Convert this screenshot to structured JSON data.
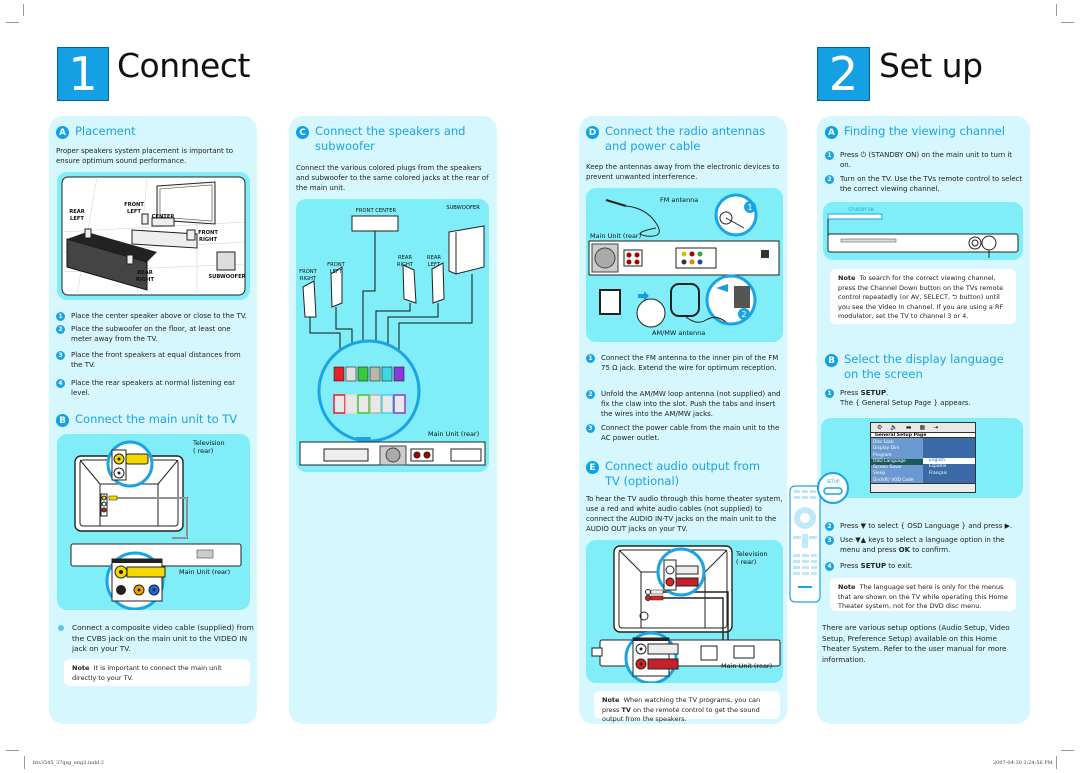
{
  "section1": {
    "number": "1",
    "title": "Connect",
    "A": {
      "letter": "A",
      "title": "Placement",
      "intro": "Proper speakers system placement is important to ensure optimum sound performance.",
      "illustration_labels": [
        "REAR LEFT",
        "FRONT LEFT",
        "CENTER",
        "FRONT RIGHT",
        "REAR RIGHT",
        "SUBWOOFER"
      ],
      "steps": [
        "Place the center speaker above or close to the TV.",
        "Place the subwoofer on the floor, at least one meter away from the TV.",
        "Place the front speakers at equal distances from the TV.",
        "Place the rear speakers at normal listening ear level."
      ]
    },
    "B": {
      "letter": "B",
      "title": "Connect the main unit to TV",
      "labels": {
        "television": "Television",
        "television_sub": "( rear)",
        "main_unit": "Main Unit (rear)"
      },
      "bullet": "Connect a composite video cable (supplied) from the CVBS jack on the main unit to the VIDEO IN jack on your TV.",
      "note_label": "Note",
      "note_text": "It is important to connect the main unit directly to your TV."
    },
    "C": {
      "letter": "C",
      "title": "Connect the speakers and subwoofer",
      "intro": "Connect the various colored plugs from the speakers and subwoofer to the same colored jacks at the rear of the main unit.",
      "labels": {
        "front_center": "FRONT CENTER",
        "subwoofer": "SUBWOOFER",
        "front_right": "FRONT RIGHT",
        "front_left": "FRONT LEFT",
        "rear_right": "REAR RIGHT",
        "rear_left": "REAR LEFT",
        "main_unit": "Main Unit (rear)"
      },
      "plug_colors": [
        "#e8202a",
        "#e0e0e0",
        "#3cc83c",
        "#b8b8a8",
        "#40d8e0",
        "#8a3ad8"
      ]
    },
    "D": {
      "letter": "D",
      "title": "Connect the radio antennas and power cable",
      "intro": "Keep the antennas away from the electronic devices to prevent unwanted interference.",
      "labels": {
        "fm": "FM antenna",
        "main_unit": "Main Unit (rear)",
        "am": "AM/MW antenna",
        "callout1": "1",
        "callout2": "2"
      },
      "steps": [
        "Connect the FM antenna to the inner pin of the FM 75 Ω jack. Extend the wire for optimum reception.",
        "Unfold the AM/MW loop antenna (not supplied) and fix the claw into the slot. Push the tabs and insert the wires into the AM/MW jacks.",
        "Connect the power cable from the main unit to the AC power outlet."
      ]
    },
    "E": {
      "letter": "E",
      "title": "Connect audio output from TV (optional)",
      "intro": "To hear the TV audio through this home theater system, use a red and white audio cables (not supplied) to connect the AUDIO IN-TV jacks on the main unit to the AUDIO OUT jacks on your TV.",
      "labels": {
        "television": "Television",
        "television_sub": "( rear)",
        "main_unit": "Main Unit (rear)"
      },
      "note_label": "Note",
      "note_pre": "When watching the TV programs, you can press ",
      "note_bold": "TV",
      "note_post": " on the remote control to get the sound output from the speakers."
    }
  },
  "section2": {
    "number": "2",
    "title": "Set up",
    "A": {
      "letter": "A",
      "title": "Finding the viewing channel",
      "steps": [
        "Press ⏻ (STANDBY ON) on the main unit to turn it on.",
        "Turn on the TV. Use the TVs remote control to select the correct viewing channel."
      ],
      "standby_label": "STANDBY ON",
      "note_label": "Note",
      "note_text": "To search for the correct viewing channel, press the Channel Down button on the TVs remote control repeatedly (or AV, SELECT, ⮌ button) until you see the Video In channel. If you are using a RF modulator, set the TV to channel 3 or 4."
    },
    "B": {
      "letter": "B",
      "title": "Select the display language on the screen",
      "step1_pre": "Press ",
      "step1_bold": "SETUP",
      "step1_post": ".",
      "step1_line2": "The { General Setup Page } appears.",
      "osd": {
        "header": "General Setup Page",
        "items": [
          "Disc Lock",
          "Display Dim",
          "Program",
          "OSD Language",
          "Screen Saver",
          "Sleep",
          "DivX(R) VOD Code"
        ],
        "selected_item": "OSD Language",
        "options": [
          "English",
          "Español",
          "Français"
        ],
        "selected_option": "English"
      },
      "setup_button_label": "SETUP",
      "step2": "Press ▼ to select { OSD Language } and press ▶.",
      "step3_pre": "Use ▼▲ keys to select a language option in the menu and press ",
      "step3_bold": "OK",
      "step3_post": " to confirm.",
      "step4_pre": "Press ",
      "step4_bold": "SETUP",
      "step4_post": " to exit.",
      "note_label": "Note",
      "note_text": "The language set here is only for the menus that are shown on the TV while operating this Home Theater system, not for the DVD disc menu.",
      "closing": "There are various setup options (Audio Setup, Video Setup, Preference Setup) available on this Home Theater System. Refer to the user manual for more information."
    }
  },
  "footer": {
    "left": "hts3545_37qsg_eng2.indd   2",
    "right": "2007-04-30   3:24:56 PM"
  }
}
